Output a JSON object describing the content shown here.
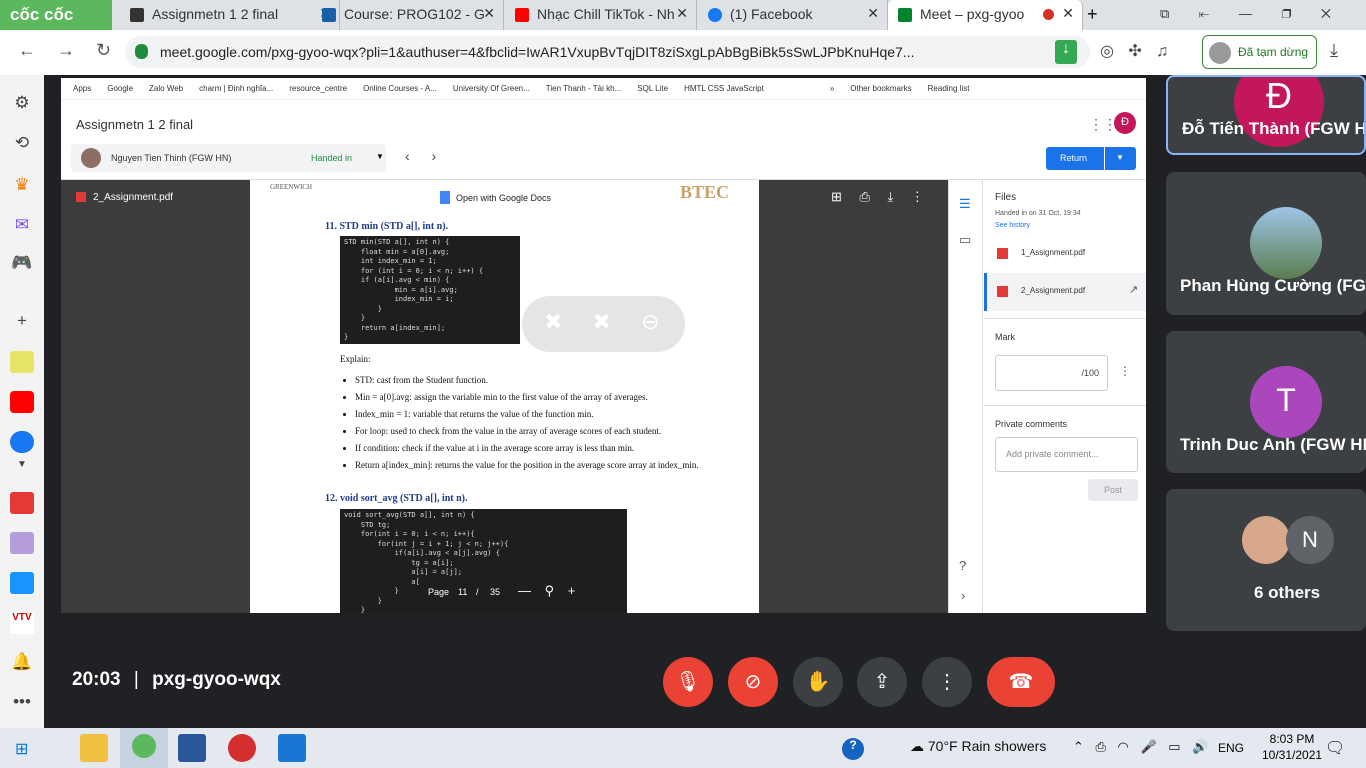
{
  "browser": {
    "logo": "cốc cốc",
    "tabs": [
      {
        "title": "Assignmetn 1 2 final",
        "color": "#333"
      },
      {
        "title": "Course: PROG102 - G",
        "color": "#1a5fa8"
      },
      {
        "title": "Nhạc Chill TikTok - Nh",
        "color": "#ff0000"
      },
      {
        "title": "(1) Facebook",
        "color": "#1877f2"
      },
      {
        "title": "Meet – pxg-gyoo",
        "color": "#00832d"
      }
    ],
    "new_tab": "+",
    "url": "meet.google.com/pxg-gyoo-wqx?pli=1&authuser=4&fbclid=IwAR1VxupBvTqjDIT8ziSxgLpAbBgBiBk5sSwLJPbKnuHqe7...",
    "profile_status": "Đã tạm dừng"
  },
  "bookmarks": [
    "Apps",
    "Google",
    "Zalo Web",
    "charm | Định nghĩa...",
    "resource_centre",
    "Online Courses - A...",
    "University Of Green...",
    "Tien Thanh - Tài kh...",
    "SQL Lite",
    "HMTL CSS JavaScript",
    "»",
    "Other bookmarks",
    "Reading list"
  ],
  "classroom": {
    "title": "Assignmetn 1 2 final",
    "student": "Nguyen Tien Thinh (FGW HN)",
    "status": "Handed in",
    "return_label": "Return",
    "avatar_letter": "Đ"
  },
  "pdf": {
    "filename": "2_Assignment.pdf",
    "open_with": "Open with Google Docs",
    "brand": "BTEC",
    "header_logo": "GREENWICH",
    "section11": "11. STD min (STD a[], int n).",
    "code11": [
      "STD min(STD a[], int n) {",
      "    float min = a[0].avg;",
      "    int index_min = 1;",
      "    for (int i = 0; i < n; i++) {",
      "    if (a[i].avg < min) {",
      "            min = a[i].avg;",
      "            index_min = i;",
      "        }",
      "    }",
      "    return a[index_min];",
      "}"
    ],
    "explain": "Explain:",
    "bullets": [
      "STD: cast from the Student function.",
      "Min = a[0].avg: assign the variable min to the first value of the array of averages.",
      "Index_min = 1: variable that returns the value of the function min.",
      "For loop: used to check from the value in the array of average scores of each student.",
      "If  condition: check if the value at i in the average score array is less than min.",
      "Return a[index_min]: returns the value for the position in the average score array at index_min."
    ],
    "section12": "12. void sort_avg (STD a[], int n).",
    "code12": [
      "void sort_avg(STD a[], int n) {",
      "    STD tg;",
      "    for(int i = 0; i < n; i++){",
      "        for(int j = i + 1; j < n; j++){",
      "            if(a[i].avg < a[j].avg) {",
      "                tg = a[i];",
      "                a[i] = a[j];",
      "                a[j] = tg;",
      "            }",
      "        }",
      "    }"
    ],
    "page_label": "Page",
    "page_current": "11",
    "page_sep": "/",
    "page_total": "35"
  },
  "panel": {
    "files_title": "Files",
    "handed_in": "Handed in on 31 Oct, 19:34",
    "see_history": "See history",
    "files": [
      "1_Assignment.pdf",
      "2_Assignment.pdf"
    ],
    "mark_label": "Mark",
    "mark_suffix": "/100",
    "private_comments": "Private comments",
    "comment_placeholder": "Add private comment...",
    "post": "Post"
  },
  "participants": [
    {
      "name": "Đỗ Tiến Thành (FGW HN)",
      "letter": "Đ",
      "color": "#c2185b"
    },
    {
      "name": "Phan Hùng Cường (FGW HN)"
    },
    {
      "name": "Trinh Duc Anh (FGW HN)",
      "letter": "T",
      "color": "#ab47bc"
    },
    {
      "name": "6 others",
      "letter": "N",
      "color": "#5f6368"
    }
  ],
  "meeting": {
    "time": "20:03",
    "sep": "|",
    "code": "pxg-gyoo-wqx"
  },
  "taskbar": {
    "weather_temp": "70°F",
    "weather_text": "Rain showers",
    "lang": "ENG",
    "time": "8:03 PM",
    "date": "10/31/2021"
  }
}
